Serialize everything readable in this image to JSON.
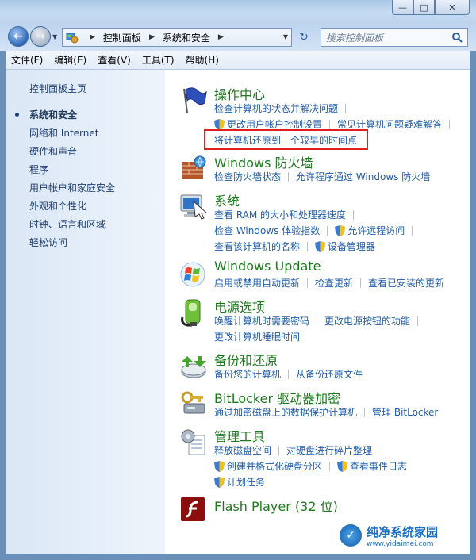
{
  "window": {
    "caption_buttons": [
      "—",
      "□",
      "✕"
    ]
  },
  "address": {
    "crumbs": [
      "控制面板",
      "系统和安全"
    ],
    "search_placeholder": "搜索控制面板"
  },
  "menu": [
    "文件(F)",
    "编辑(E)",
    "查看(V)",
    "工具(T)",
    "帮助(H)"
  ],
  "sidebar": {
    "items": [
      "控制面板主页",
      "系统和安全",
      "网络和 Internet",
      "硬件和声音",
      "程序",
      "用户帐户和家庭安全",
      "外观和个性化",
      "时钟、语言和区域",
      "轻松访问"
    ],
    "active_index": 1
  },
  "categories": [
    {
      "title": "操作中心",
      "icon": "flag-icon",
      "rows": [
        [
          "检查计算机的状态并解决问题"
        ],
        [
          "更改用户帐户控制设置",
          "常见计算机问题疑难解答"
        ],
        [
          "将计算机还原到一个较早的时间点"
        ]
      ]
    },
    {
      "title": "Windows 防火墙",
      "icon": "firewall-icon",
      "rows": [
        [
          "检查防火墙状态",
          "允许程序通过 Windows 防火墙"
        ]
      ]
    },
    {
      "title": "系统",
      "icon": "computer-icon",
      "rows": [
        [
          "查看 RAM 的大小和处理器速度"
        ],
        [
          "检查 Windows 体验指数",
          "允许远程访问"
        ],
        [
          "查看该计算机的名称",
          "设备管理器"
        ]
      ]
    },
    {
      "title": "Windows Update",
      "icon": "windows-update-icon",
      "rows": [
        [
          "启用或禁用自动更新",
          "检查更新",
          "查看已安装的更新"
        ]
      ]
    },
    {
      "title": "电源选项",
      "icon": "power-icon",
      "rows": [
        [
          "唤醒计算机时需要密码",
          "更改电源按钮的功能"
        ],
        [
          "更改计算机睡眠时间"
        ]
      ]
    },
    {
      "title": "备份和还原",
      "icon": "backup-icon",
      "rows": [
        [
          "备份您的计算机",
          "从备份还原文件"
        ]
      ]
    },
    {
      "title": "BitLocker 驱动器加密",
      "icon": "bitlocker-icon",
      "rows": [
        [
          "通过加密磁盘上的数据保护计算机",
          "管理 BitLocker"
        ]
      ]
    },
    {
      "title": "管理工具",
      "icon": "admin-tools-icon",
      "rows": [
        [
          "释放磁盘空间",
          "对硬盘进行碎片整理"
        ],
        [
          "创建并格式化硬盘分区",
          "查看事件日志"
        ],
        [
          "计划任务"
        ]
      ]
    },
    {
      "title": "Flash Player (32 位)",
      "icon": "flash-icon",
      "rows": []
    }
  ],
  "watermark": {
    "name": "纯净系统家园",
    "url": "www.yidaimei.com"
  }
}
